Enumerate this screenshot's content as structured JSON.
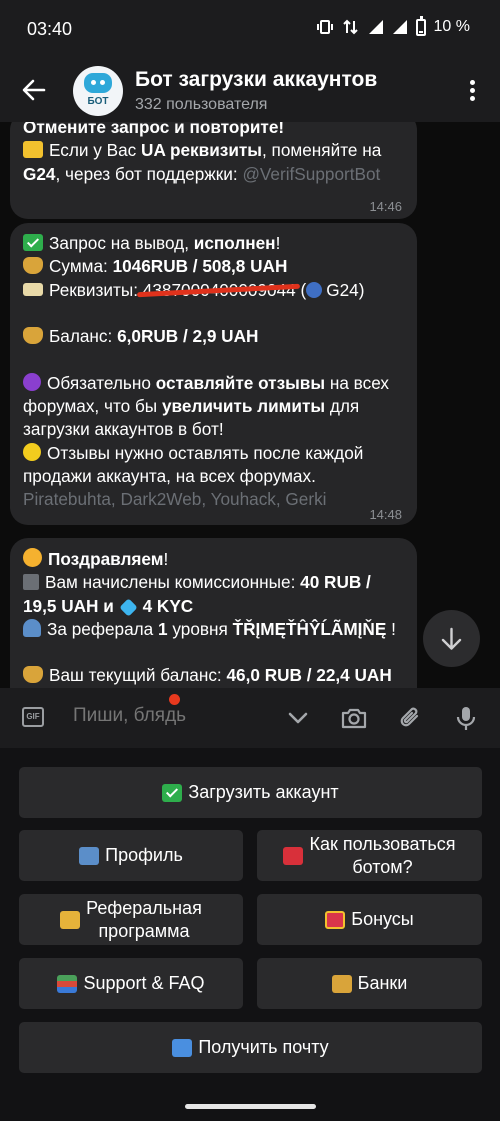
{
  "status_bar": {
    "time": "03:40",
    "battery": "10 %"
  },
  "header": {
    "title": "Бот загрузки аккаунтов",
    "subtitle": "332 пользователя",
    "avatar_label": "БОТ"
  },
  "messages": [
    {
      "partial_top": "Отмените запрос и повторите!",
      "line1_a": "Если у Вас ",
      "line1_b": "UA реквизиты",
      "line1_c": ", поменяйте на",
      "line2_a": "G24",
      "line2_b": ", через бот поддержки: ",
      "line2_c": "@VerifSupportBot",
      "time": "14:46"
    },
    {
      "l1_a": "Запрос на вывод, ",
      "l1_b": "исполнен",
      "l1_c": "!",
      "l2_a": "Сумма: ",
      "l2_b": "1046RUB  / 508,8 UAH",
      "l3_a": "Реквизиты: ",
      "l3_redacted": "4387000400009044",
      "l3_b": " (",
      "l3_c": "G24)",
      "l4_a": "Баланс: ",
      "l4_b": "6,0RUB  / 2,9 UAH",
      "l5_a": "Обязательно ",
      "l5_b": "оставляйте отзывы",
      "l5_c": " на всех",
      "l6_a": "форумах, что бы ",
      "l6_b": "увеличить лимиты",
      "l6_c": " для",
      "l7": "загрузки аккаунтов в бот!",
      "l8": "Отзывы нужно оставлять после каждой",
      "l9": "продажи аккаунта, на всех форумах.",
      "l10": "Piratebuhta, Dark2Web, Youhack, Gerki",
      "time": "14:48"
    },
    {
      "l1_a": "Поздравляем",
      "l1_b": "!",
      "l2_a": "Вам начислены комиссионные: ",
      "l2_b": "40 RUB  /",
      "l3_a": "19,5 UAH и ",
      "l3_b": "4 KYC",
      "l4_a": "За реферала ",
      "l4_b": "1",
      "l4_c": " уровня ",
      "l4_d": "ŤŘĮMĘŤĤŶĹÃMĮŇĘ",
      "l4_e": " !",
      "l5_a": "Ваш текущий баланс:  ",
      "l5_b": "46,0 RUB  / 22,4 UAH"
    }
  ],
  "input": {
    "placeholder": "Пиши, блядь"
  },
  "keyboard": {
    "upload": "Загрузить аккаунт",
    "profile": "Профиль",
    "howto": "Как пользоваться\nботом?",
    "referral": "Реферальная\nпрограмма",
    "bonuses": "Бонусы",
    "support": "Support & FAQ",
    "banks": "Банки",
    "mail": "Получить почту"
  },
  "colors": {
    "accent_red": "#e8391e",
    "bubble": "#262628",
    "header": "#1c1c1e"
  }
}
